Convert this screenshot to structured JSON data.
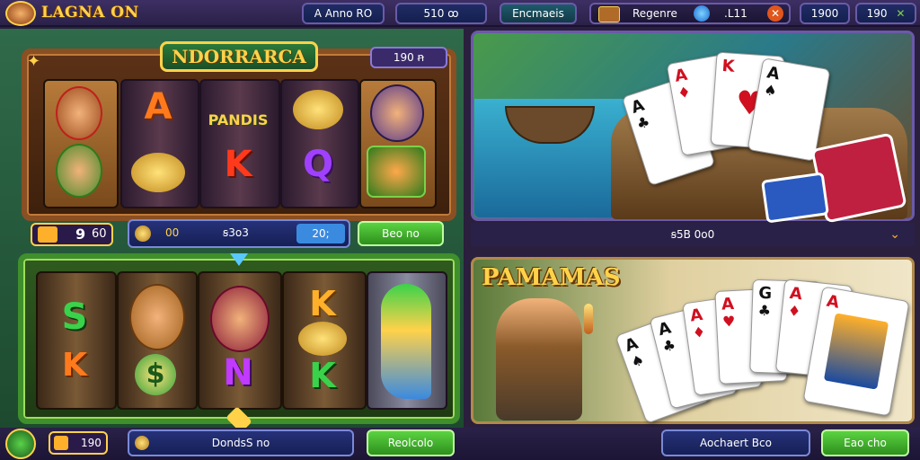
{
  "header": {
    "logo_text": "LAGNA ON",
    "pill1_text": "A Anno  RO",
    "pill2_text": "510  ꝏ",
    "pill3_text": "Encmaeis",
    "bonus_label": "Regenre",
    "level_text": ".L11",
    "coins_text": "1900",
    "gems_text": "190"
  },
  "slot_top": {
    "title": "NDORRARCA",
    "badge_text": "190  ꞥ",
    "reel_symbols": [
      "A",
      "PANDIS",
      "K",
      "Q"
    ],
    "bet_value": "9",
    "bet_small": "60",
    "win_left": "00",
    "win_mid": "ꞩ3o3",
    "win_right": "20;",
    "spin_label": "Beo no"
  },
  "slot_bottom": {
    "reel_symbols": [
      "S",
      "K",
      "$",
      "N",
      "K",
      "K"
    ],
    "credit_value": "190",
    "deposit_label": "DondsS no",
    "play_label": "Reolcolo"
  },
  "card_top": {
    "footer_text": "ꞩ5B 0o0"
  },
  "card_bottom": {
    "title": "PAMAMAS",
    "card_ranks": [
      "A",
      "A",
      "A",
      "A",
      "G",
      "A",
      "A"
    ],
    "action_label": "Aochaert Bco",
    "confirm_label": "Eao cho"
  },
  "colors": {
    "gold": "#ffd24a",
    "wood": "#8a4f22",
    "green": "#3f8f2c",
    "purple": "#3d2f63"
  }
}
